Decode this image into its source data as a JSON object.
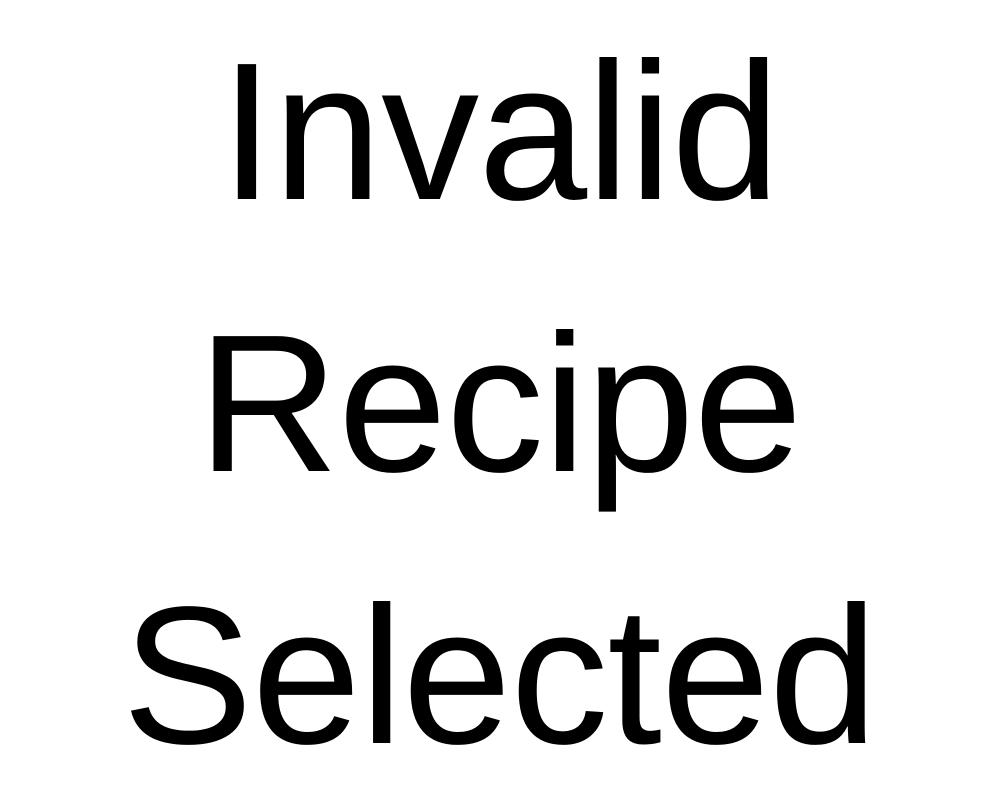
{
  "message": {
    "lines": [
      "Invalid",
      "Recipe",
      "Selected"
    ]
  },
  "colors": {
    "background": "#ffffff",
    "text": "#000000"
  }
}
